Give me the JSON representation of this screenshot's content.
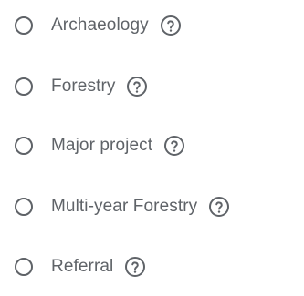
{
  "options": [
    {
      "label": "Archaeology",
      "help_icon": "help-circle-icon"
    },
    {
      "label": "Forestry",
      "help_icon": "help-circle-icon"
    },
    {
      "label": "Major project",
      "help_icon": "help-circle-icon"
    },
    {
      "label": "Multi-year Forestry",
      "help_icon": "help-circle-icon"
    },
    {
      "label": "Referral",
      "help_icon": "help-circle-icon"
    }
  ],
  "colors": {
    "text": "#5f6368",
    "radio_border": "#5f6368",
    "background": "#ffffff"
  }
}
